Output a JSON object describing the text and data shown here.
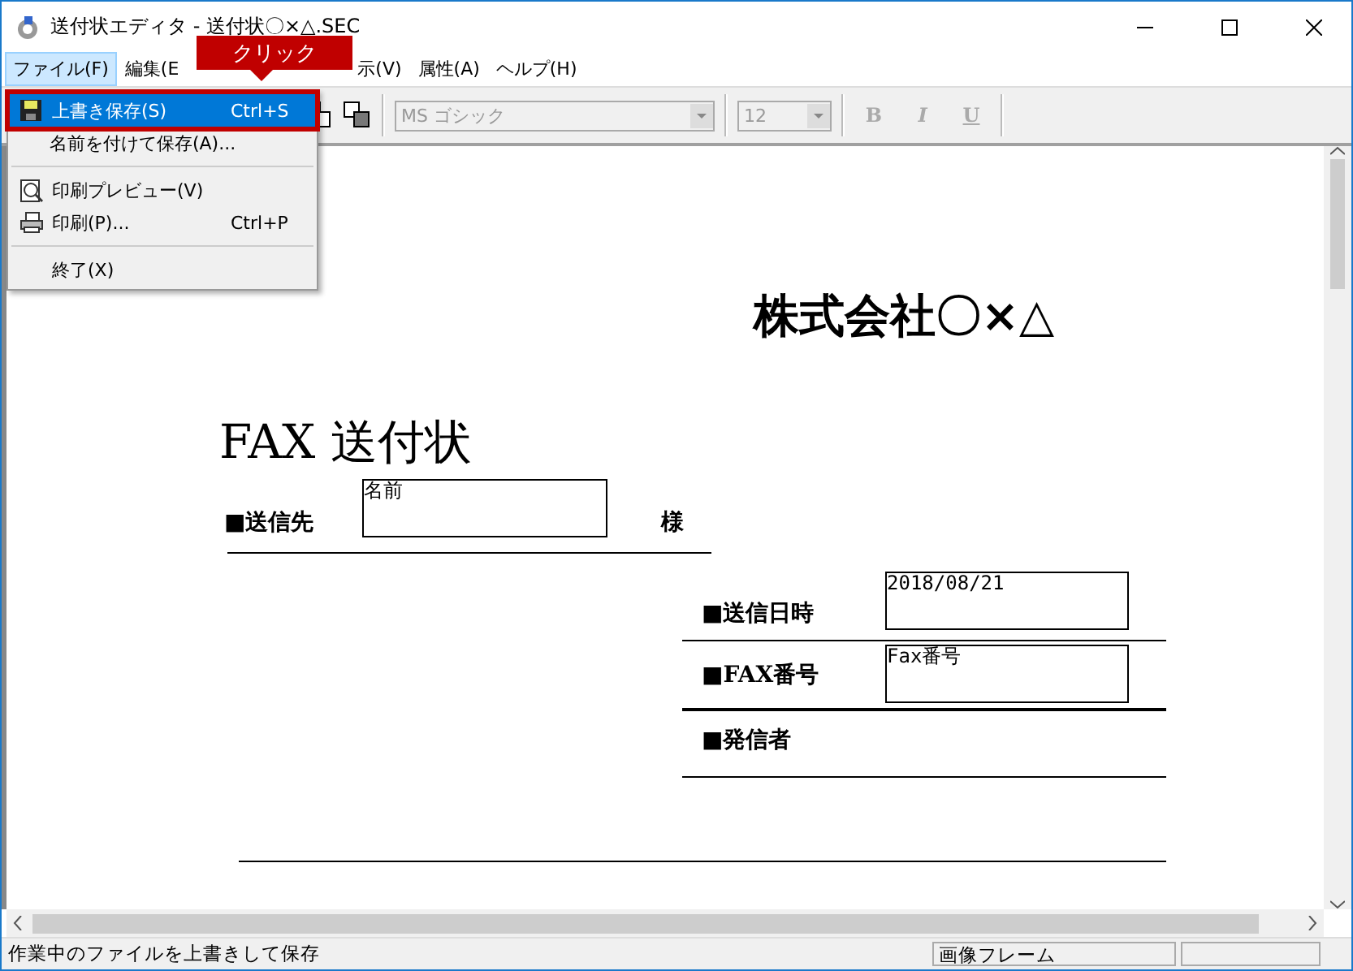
{
  "window": {
    "title": "送付状エディタ - 送付状〇×△.SEC"
  },
  "menu_bar": [
    {
      "label": "ファイル(F)",
      "selected": true
    },
    {
      "label": "編集(E",
      "selected": false
    },
    {
      "label": "示(V)",
      "selected": false
    },
    {
      "label": "属性(A)",
      "selected": false
    },
    {
      "label": "ヘルプ(H)",
      "selected": false
    }
  ],
  "callout": "クリック",
  "file_menu": [
    {
      "kind": "item",
      "label": "上書き保存(S)",
      "shortcut": "Ctrl+S",
      "selected": true
    },
    {
      "kind": "item",
      "label": "名前を付けて保存(A)...",
      "selected": false
    },
    {
      "kind": "separator"
    },
    {
      "kind": "item",
      "label": "印刷プレビュー(V)",
      "selected": false
    },
    {
      "kind": "item",
      "label": "印刷(P)...",
      "shortcut": "Ctrl+P",
      "selected": false
    },
    {
      "kind": "separator"
    },
    {
      "kind": "item",
      "label": "終了(X)",
      "selected": false
    }
  ],
  "toolbar": {
    "font": "MS ゴシック",
    "size": "12",
    "format_buttons": [
      "B",
      "I",
      "U"
    ],
    "disabled": true
  },
  "document": {
    "company": "株式会社〇×△",
    "title": "FAX 送付状",
    "recipient": {
      "label": "■送信先",
      "value": "名前",
      "honorific": "様"
    },
    "fields": [
      {
        "label": "■送信日時",
        "value": "2018/08/21"
      },
      {
        "label": "■FAX番号",
        "value": "Fax番号"
      },
      {
        "label": "■発信者"
      }
    ]
  },
  "status_bar": [
    "作業中のファイルを上書きして保存",
    "画像フレーム"
  ]
}
